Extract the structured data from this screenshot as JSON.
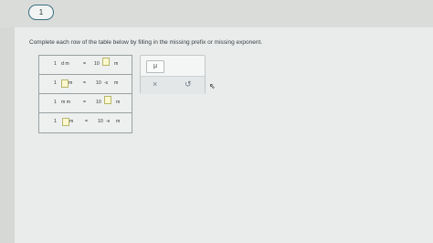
{
  "question": {
    "number": "1"
  },
  "instruction": "Complete each row of the table below by filling in the missing prefix or missing exponent.",
  "table": {
    "rows": [
      {
        "lhs_num": "1",
        "lhs_unit": "d m",
        "eq": "=",
        "base": "10",
        "exp": "",
        "unit": "m"
      },
      {
        "lhs_num": "1",
        "lhs_unit": "m",
        "eq": "=",
        "base": "10",
        "exp": "-6",
        "unit": "m"
      },
      {
        "lhs_num": "1",
        "lhs_unit": "m m",
        "eq": "=",
        "base": "10",
        "exp": "",
        "unit": "m"
      },
      {
        "lhs_num": "1",
        "lhs_unit": "m",
        "eq": "=",
        "base": "10",
        "exp": "-9",
        "unit": "m"
      }
    ]
  },
  "panel": {
    "mu_label": "μ",
    "clear_symbol": "×",
    "undo_symbol": "↺"
  }
}
